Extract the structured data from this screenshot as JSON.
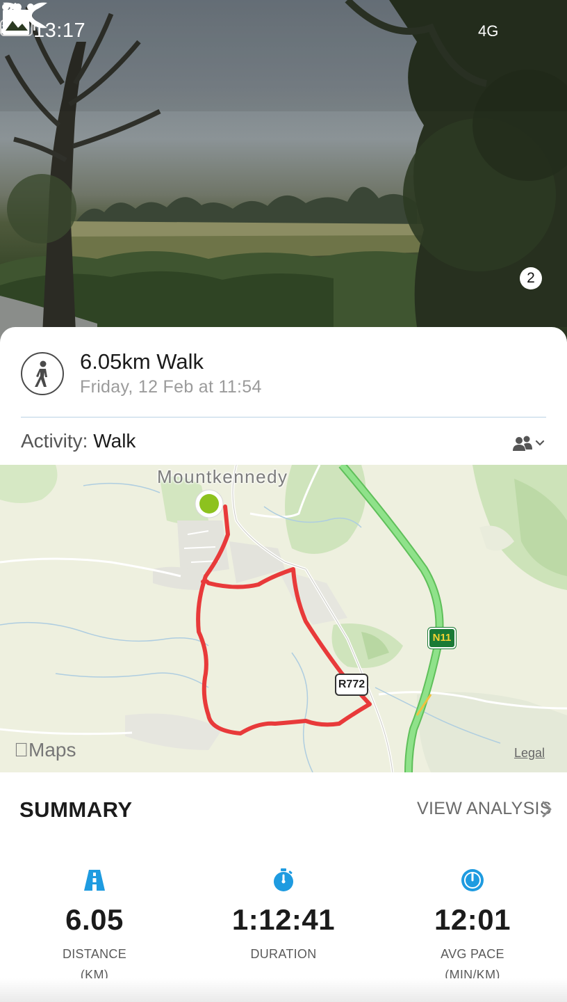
{
  "status_bar": {
    "time": "13:17",
    "network": "4G",
    "battery_level": 0.3
  },
  "header": {
    "back_icon": "chevron-left-icon",
    "logo": "under-armour-logo",
    "more_icon": "ellipsis-icon",
    "photos_icon": "photo-icon",
    "photos_count": "2"
  },
  "workout": {
    "icon": "walking-person-icon",
    "title": "6.05km Walk",
    "date": "Friday, 12 Feb at 11:54",
    "activity_label": "Activity:",
    "activity_value": "Walk",
    "privacy_icon": "friends-icon"
  },
  "map": {
    "place_label": "Mountkennedy",
    "road_n11": "N11",
    "road_r772": "R772",
    "provider": "Maps",
    "legal": "Legal",
    "route_color": "#e83a3a",
    "start_marker_color": "#8dc21f",
    "motorway_color": "#7fd67a"
  },
  "summary": {
    "title": "SUMMARY",
    "view_analysis": "VIEW ANALYSIS",
    "accent_color": "#1e9be0",
    "stats": [
      {
        "icon": "road-icon",
        "value": "6.05",
        "label": "DISTANCE",
        "unit": "(KM)"
      },
      {
        "icon": "stopwatch-icon",
        "value": "1:12:41",
        "label": "DURATION",
        "unit": ""
      },
      {
        "icon": "speedometer-icon",
        "value": "12:01",
        "label": "AVG PACE",
        "unit": "(MIN/KM)"
      }
    ]
  }
}
